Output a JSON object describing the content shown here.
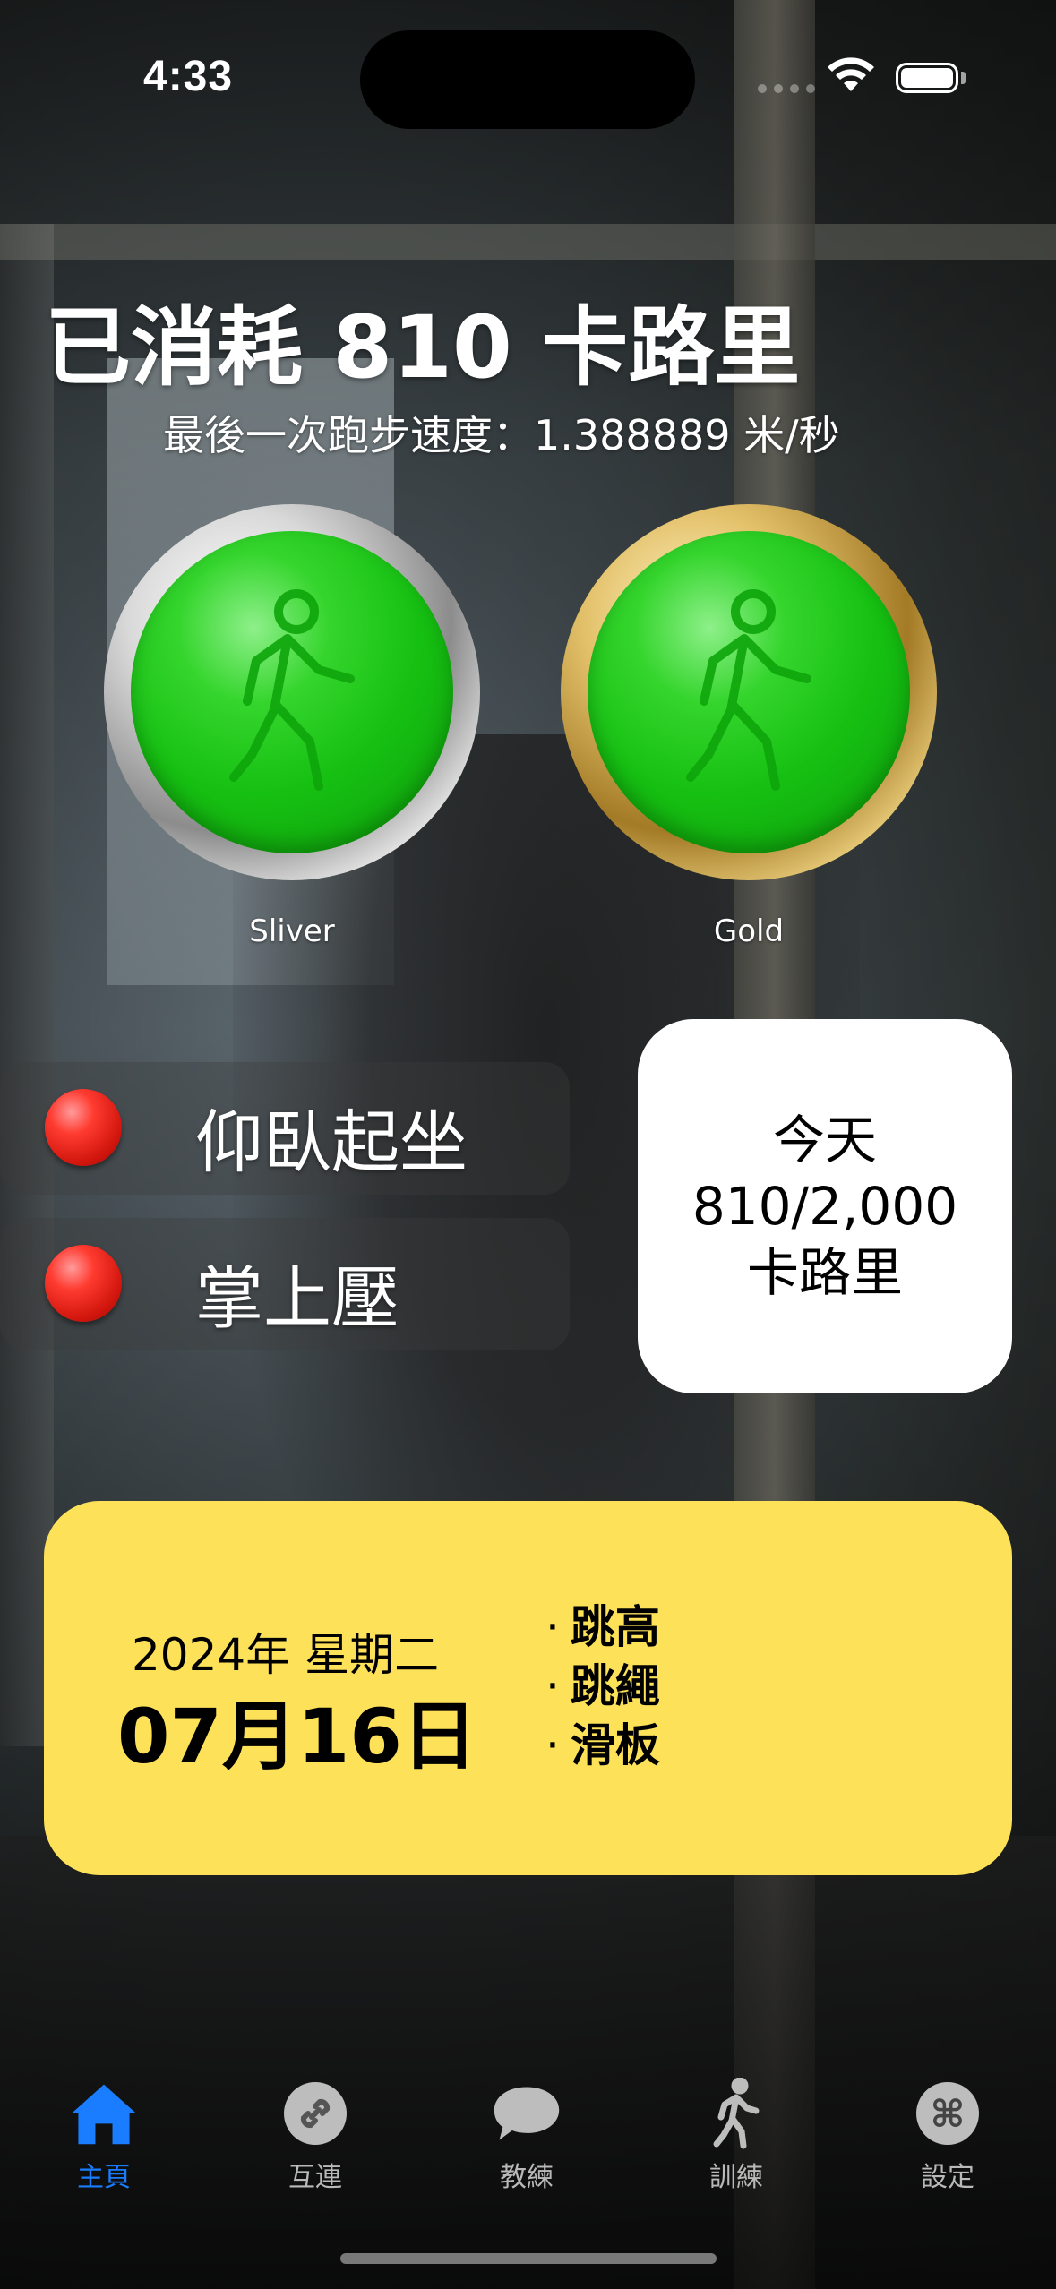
{
  "status_bar": {
    "time": "4:33"
  },
  "header": {
    "title": "已消耗 810 卡路里",
    "subtitle": "最後一次跑步速度：1.388889 米/秒"
  },
  "medals": [
    {
      "label": "Sliver",
      "ring": "silver",
      "icon": "walking-figure-icon"
    },
    {
      "label": "Gold",
      "ring": "gold",
      "icon": "walking-figure-icon"
    }
  ],
  "exercises": [
    {
      "label": "仰臥起坐",
      "status_color": "#ff3b30"
    },
    {
      "label": "掌上壓",
      "status_color": "#ff3b30"
    }
  ],
  "today_card": {
    "line1": "今天",
    "line2": "810/2,000",
    "line3": "卡路里"
  },
  "calendar_card": {
    "year_weekday": "2024年 星期二",
    "date": "07月16日",
    "activities": [
      "跳高",
      "跳繩",
      "滑板"
    ],
    "bullet": "·"
  },
  "tab_bar": {
    "active_color": "#1a7dff",
    "tabs": [
      {
        "label": "主頁",
        "icon": "house-icon",
        "active": true
      },
      {
        "label": "互連",
        "icon": "link-icon",
        "active": false
      },
      {
        "label": "教練",
        "icon": "chat-bubble-icon",
        "active": false
      },
      {
        "label": "訓練",
        "icon": "walking-figure-icon",
        "active": false
      },
      {
        "label": "設定",
        "icon": "command-icon",
        "active": false
      }
    ]
  },
  "colors": {
    "card_yellow": "#fde159",
    "medal_green": "#16c012"
  }
}
